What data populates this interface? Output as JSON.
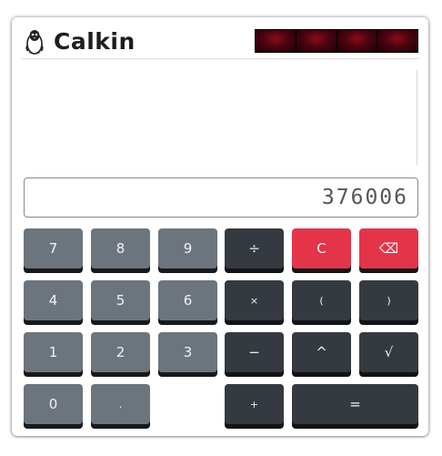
{
  "app": {
    "title": "Calkin",
    "logo_icon": "tux-penguin-icon"
  },
  "lcd": {
    "cells": 4,
    "color": "#6a0612"
  },
  "display": {
    "value": "376006"
  },
  "keys": {
    "seven": "7",
    "eight": "8",
    "nine": "9",
    "divide": "÷",
    "clear": "C",
    "backspace": "⌫",
    "four": "4",
    "five": "5",
    "six": "6",
    "multiply": "×",
    "paren_open": "(",
    "paren_close": ")",
    "one": "1",
    "two": "2",
    "three": "3",
    "minus": "−",
    "power": "^",
    "sqrt": "√",
    "zero": "0",
    "dot": ".",
    "plus": "+",
    "equals": "="
  },
  "colors": {
    "number_key": "#6c757d",
    "operator_key": "#343a40",
    "clear_key": "#e3344a"
  }
}
